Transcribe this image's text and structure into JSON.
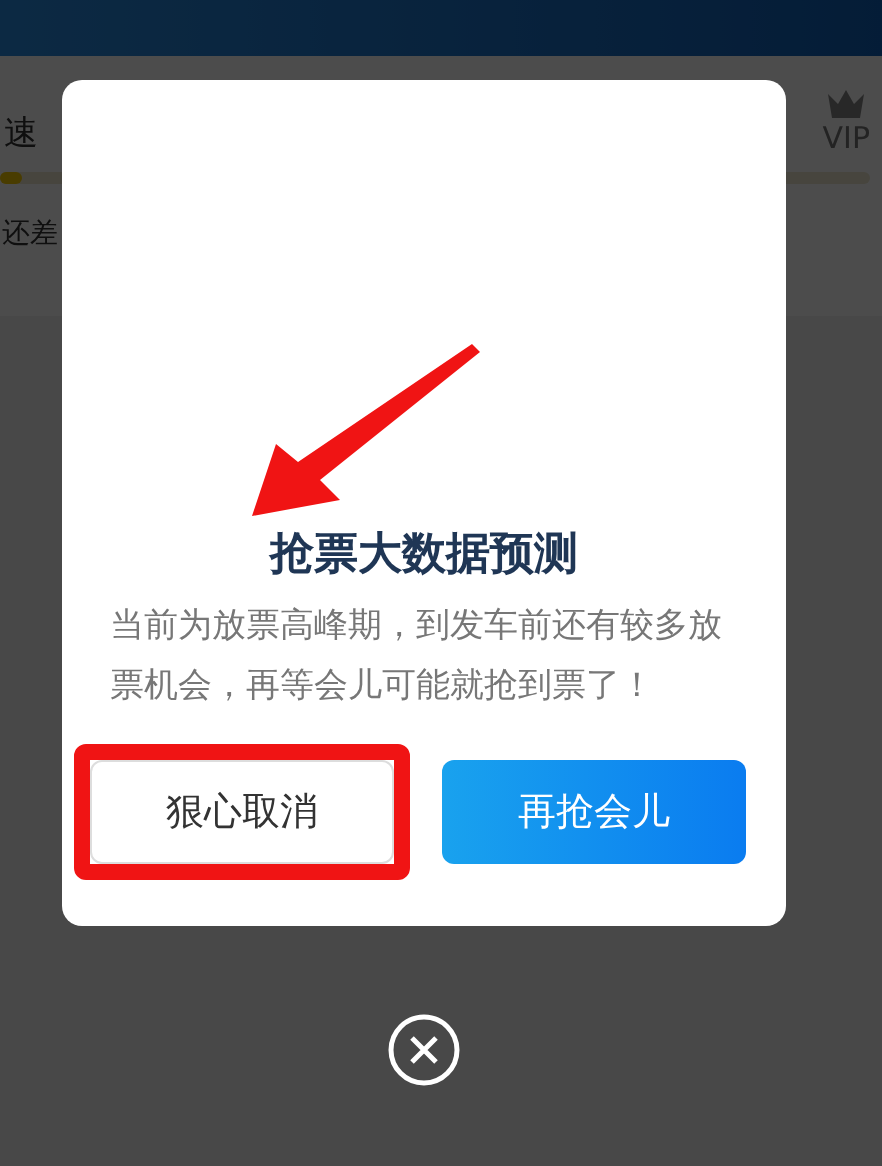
{
  "background_page": {
    "speed_label": "速",
    "progress": {
      "level": 0.025
    },
    "vip_label": "VIP",
    "hint": "还差"
  },
  "dialog": {
    "title": "抢票大数据预测",
    "message": "当前为放票高峰期，到发车前还有较多放票机会，再等会儿可能就抢到票了！",
    "buttons": [
      {
        "label": "狠心取消",
        "kind": "secondary",
        "highlighted": true
      },
      {
        "label": "再抢会儿",
        "kind": "primary",
        "highlighted": false
      }
    ]
  }
}
